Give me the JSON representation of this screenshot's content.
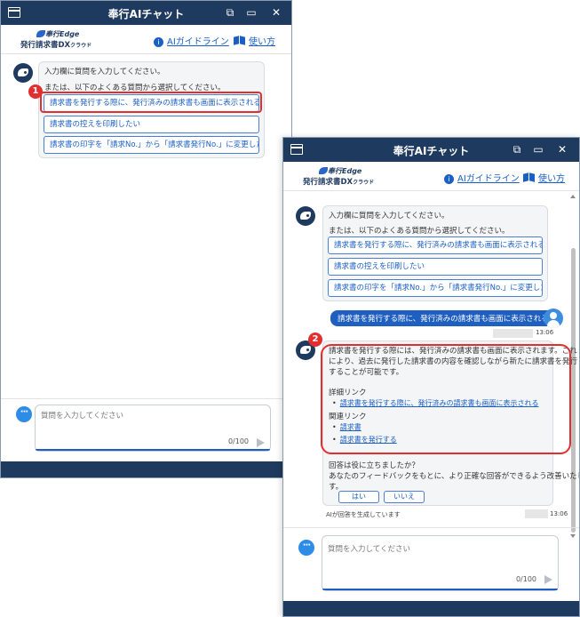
{
  "window1": {
    "title": "奉行AIチャット",
    "logo": {
      "line1": "奉行Edge",
      "line2": "発行請求書DX",
      "line2_small": "クラウド"
    },
    "header_links": {
      "ai_guideline": "AIガイドライン",
      "how_to": "使い方"
    },
    "bot_message": {
      "line1": "入力欄に質問を入力してください。",
      "line2": "または、以下のよくある質問から選択してください。",
      "options": [
        "請求書を発行する際に、発行済みの請求書も画面に表示される",
        "請求書の控えを印刷したい",
        "請求書の印字を「請求No.」から「請求書発行No.」に変更したい"
      ]
    },
    "marker": "1",
    "input": {
      "placeholder": "質問を入力してください",
      "counter": "0/100"
    }
  },
  "window2": {
    "title": "奉行AIチャット",
    "logo": {
      "line1": "奉行Edge",
      "line2": "発行請求書DX",
      "line2_small": "クラウド"
    },
    "header_links": {
      "ai_guideline": "AIガイドライン",
      "how_to": "使い方"
    },
    "bot_message": {
      "line1": "入力欄に質問を入力してください。",
      "line2": "または、以下のよくある質問から選択してください。",
      "options": [
        "請求書を発行する際に、発行済みの請求書も画面に表示される",
        "請求書の控えを印刷したい",
        "請求書の印字を「請求No.」から「請求書発行No.」に変更したい"
      ]
    },
    "user_message": {
      "text": "請求書を発行する際に、発行済みの請求書も画面に表示される",
      "time": "13:06"
    },
    "answer": {
      "lines": [
        "請求書を発行する際には、発行済みの請求書も画面に表示されます。これ",
        "により、過去に発行した請求書の内容を確認しながら新たに請求書を発行",
        "することが可能です。"
      ],
      "detail_heading": "詳細リンク",
      "detail_links": [
        "請求書を発行する際に、発行済みの請求書も画面に表示される"
      ],
      "related_heading": "関連リンク",
      "related_links": [
        "請求書",
        "請求書を発行する"
      ],
      "feedback_q1": "回答は役に立ちましたか？",
      "feedback_q2": "あなたのフィードバックをもとに、より正確な回答ができるよう改善いたしま",
      "feedback_q3": "す。",
      "yes": "はい",
      "no": "いいえ",
      "generated_note": "AIが回答を生成しています",
      "time": "13:06"
    },
    "marker": "2",
    "input": {
      "placeholder": "質問を入力してください",
      "counter": "0/100"
    }
  }
}
